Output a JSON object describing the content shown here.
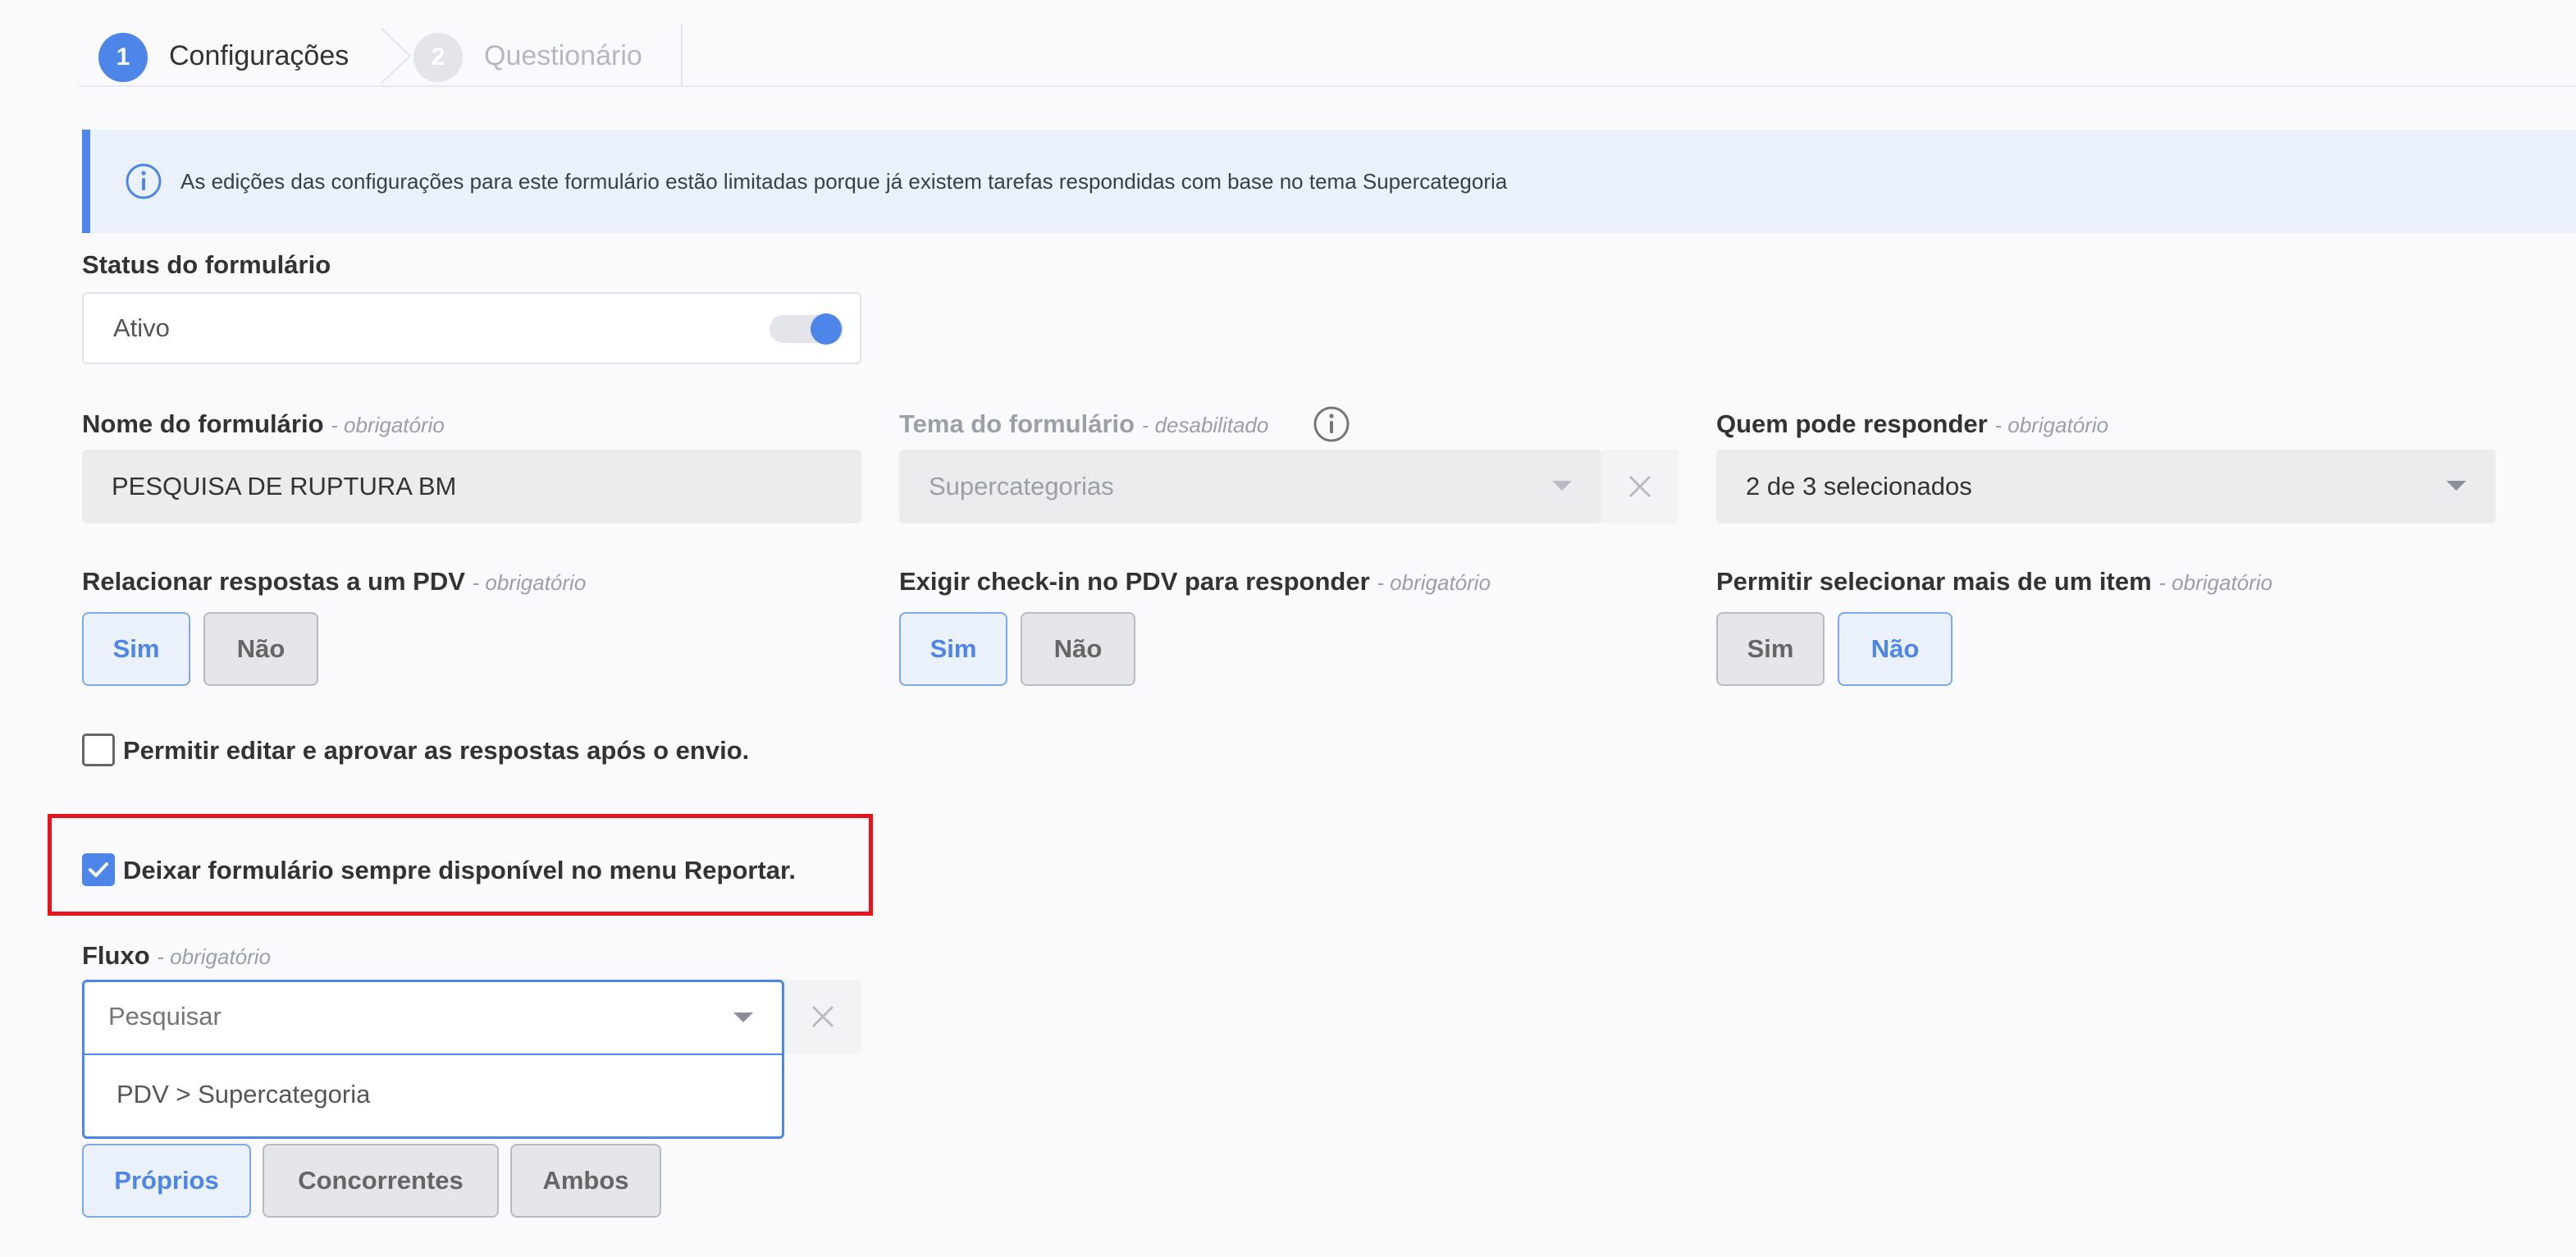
{
  "steps": [
    {
      "number": "1",
      "label": "Configurações"
    },
    {
      "number": "2",
      "label": "Questionário"
    }
  ],
  "banner": {
    "icon": "info-icon",
    "text": "As edições das configurações para este formulário estão limitadas porque já existem tarefas respondidas com base no tema Supercategoria"
  },
  "status": {
    "label": "Status do formulário",
    "value": "Ativo",
    "toggle_on": true
  },
  "nome": {
    "label": "Nome do formulário",
    "hint": "- obrigatório",
    "value": "PESQUISA DE RUPTURA BM"
  },
  "tema": {
    "label": "Tema do formulário",
    "hint": "- desabilitado",
    "value": "Supercategorias"
  },
  "quem": {
    "label": "Quem pode responder",
    "hint": "- obrigatório",
    "value": "2 de 3 selecionados"
  },
  "relacionar": {
    "label": "Relacionar respostas a um PDV",
    "hint": "- obrigatório",
    "yes": "Sim",
    "no": "Não",
    "selected": "yes"
  },
  "checkin": {
    "label": "Exigir check-in no PDV para responder",
    "hint": "- obrigatório",
    "yes": "Sim",
    "no": "Não",
    "selected": "yes"
  },
  "multi": {
    "label": "Permitir selecionar mais de um item",
    "hint": "- obrigatório",
    "yes": "Sim",
    "no": "Não",
    "selected": "no"
  },
  "editar": {
    "label": "Permitir editar e aprovar as respostas após o envio.",
    "checked": false
  },
  "reportar": {
    "label": "Deixar formulário sempre disponível no menu Reportar.",
    "checked": true,
    "highlight_color": "#e8141b"
  },
  "fluxo": {
    "label": "Fluxo",
    "hint": "- obrigatório",
    "placeholder": "Pesquisar",
    "options": [
      "PDV > Supercategoria"
    ]
  },
  "origem": {
    "buttons": [
      "Próprios",
      "Concorrentes",
      "Ambos"
    ],
    "selected": "Próprios"
  },
  "colors": {
    "accent": "#4d86e8",
    "banner_bg": "#eaf1fb"
  }
}
